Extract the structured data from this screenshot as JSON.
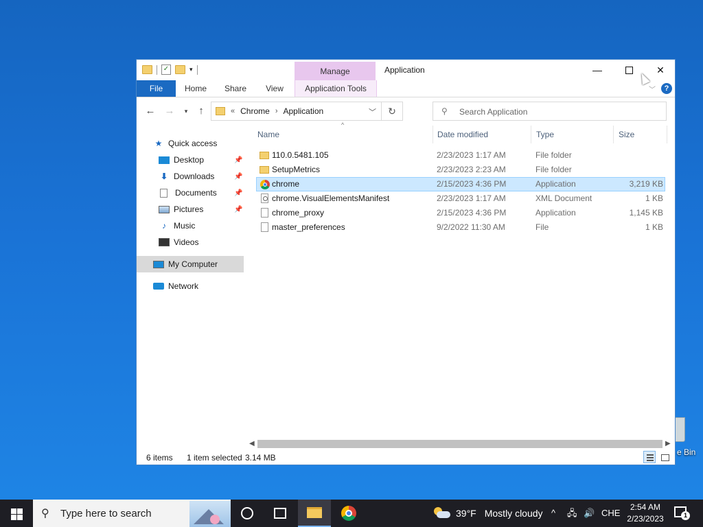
{
  "desktop": {
    "recycle_bin_label": "e Bin"
  },
  "window": {
    "title": "Application",
    "context_tab_group": "Manage",
    "ribbon_tabs": [
      "File",
      "Home",
      "Share",
      "View",
      "Application Tools"
    ],
    "controls": {
      "minimize": "—",
      "maximize": "",
      "close": "✕"
    },
    "help": "?"
  },
  "address": {
    "overflow": "«",
    "segments": [
      "Chrome",
      "Application"
    ],
    "separator": "›"
  },
  "search": {
    "placeholder": "Search Application"
  },
  "nav_pane": {
    "items": [
      {
        "label": "Quick access",
        "icon": "star-icon",
        "pinned": false
      },
      {
        "label": "Desktop",
        "icon": "desktop-icon",
        "pinned": true
      },
      {
        "label": "Downloads",
        "icon": "download-icon",
        "pinned": true
      },
      {
        "label": "Documents",
        "icon": "documents-icon",
        "pinned": true
      },
      {
        "label": "Pictures",
        "icon": "pictures-icon",
        "pinned": true
      },
      {
        "label": "Music",
        "icon": "music-icon",
        "pinned": false
      },
      {
        "label": "Videos",
        "icon": "videos-icon",
        "pinned": false
      },
      {
        "label": "My Computer",
        "icon": "computer-icon",
        "pinned": false,
        "selected": true
      },
      {
        "label": "Network",
        "icon": "network-icon",
        "pinned": false
      }
    ]
  },
  "columns": [
    "Name",
    "Date modified",
    "Type",
    "Size"
  ],
  "files": [
    {
      "name": "110.0.5481.105",
      "date": "2/23/2023 1:17 AM",
      "type": "File folder",
      "size": "",
      "icon": "folder-icon"
    },
    {
      "name": "SetupMetrics",
      "date": "2/23/2023 2:23 AM",
      "type": "File folder",
      "size": "",
      "icon": "folder-icon"
    },
    {
      "name": "chrome",
      "date": "2/15/2023 4:36 PM",
      "type": "Application",
      "size": "3,219 KB",
      "icon": "chrome-icon",
      "selected": true
    },
    {
      "name": "chrome.VisualElementsManifest",
      "date": "2/23/2023 1:17 AM",
      "type": "XML Document",
      "size": "1 KB",
      "icon": "xml-file-icon"
    },
    {
      "name": "chrome_proxy",
      "date": "2/15/2023 4:36 PM",
      "type": "Application",
      "size": "1,145 KB",
      "icon": "file-icon"
    },
    {
      "name": "master_preferences",
      "date": "9/2/2022 11:30 AM",
      "type": "File",
      "size": "1 KB",
      "icon": "file-icon"
    }
  ],
  "status": {
    "item_count": "6 items",
    "selection": "1 item selected",
    "selection_size": "3.14 MB"
  },
  "taskbar": {
    "search_placeholder": "Type here to search",
    "weather_temp": "39°F",
    "weather_desc": "Mostly cloudy",
    "language": "CHE",
    "time": "2:54 AM",
    "date": "2/23/2023",
    "notification_count": "1"
  }
}
